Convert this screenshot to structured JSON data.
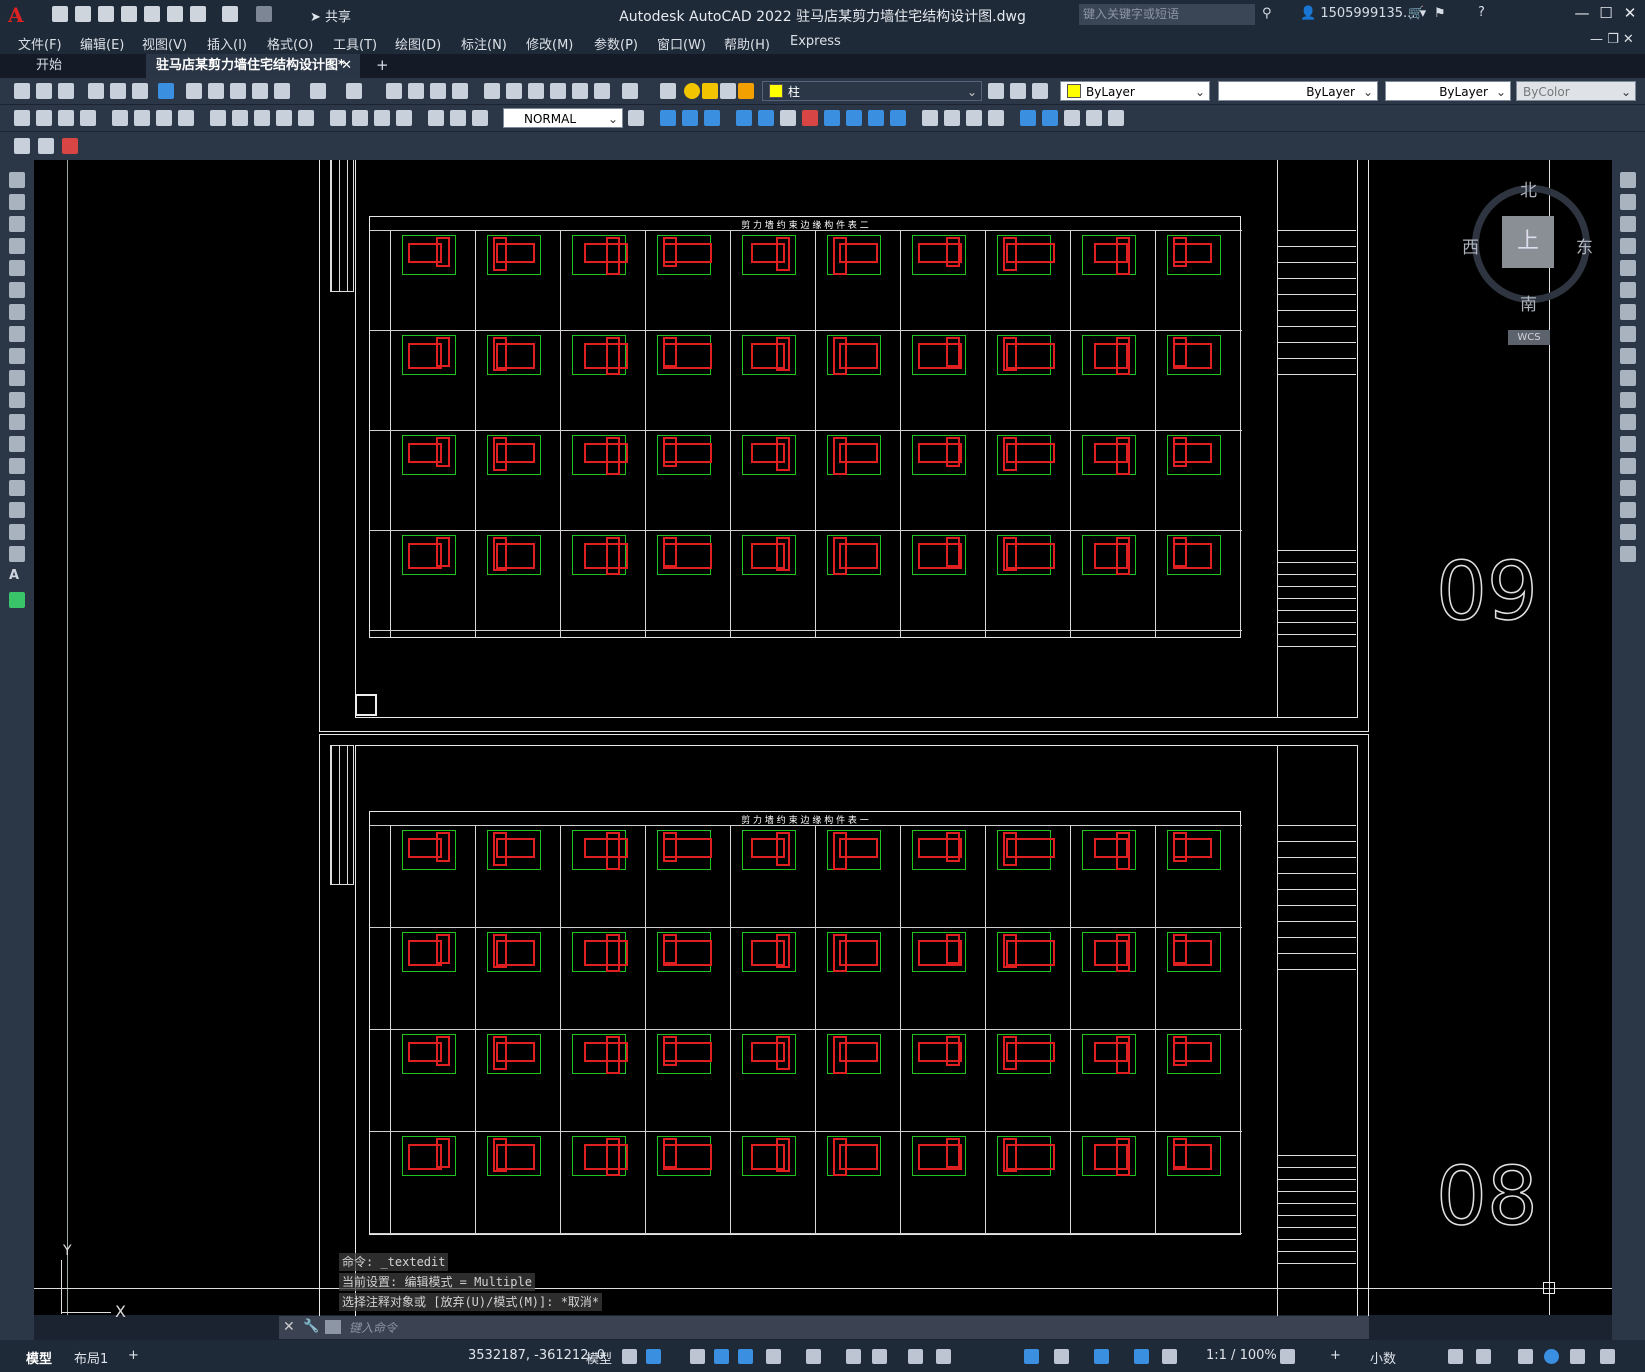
{
  "app": {
    "title": "Autodesk AutoCAD 2022    驻马店某剪力墙住宅结构设计图.dwg",
    "share_label": "共享",
    "search_placeholder": "键入关键字或短语",
    "user": "1505999135...",
    "logo": "A"
  },
  "menu": [
    "文件(F)",
    "编辑(E)",
    "视图(V)",
    "插入(I)",
    "格式(O)",
    "工具(T)",
    "绘图(D)",
    "标注(N)",
    "修改(M)",
    "参数(P)",
    "窗口(W)",
    "帮助(H)",
    "Express"
  ],
  "tabs": [
    {
      "label": "开始"
    },
    {
      "label": "驻马店某剪力墙住宅结构设计图*"
    }
  ],
  "toolbar": {
    "layer_combo": "柱",
    "color_combo": "ByLayer",
    "linetype_combo": "ByLayer",
    "lineweight_combo": "ByLayer",
    "plotstyle_combo": "ByColor",
    "textstyle_combo": "NORMAL"
  },
  "viewcube": {
    "north": "北",
    "south": "南",
    "east": "东",
    "west": "西",
    "top": "上",
    "wcs": "WCS"
  },
  "drawing": {
    "sheet_upper": {
      "number": "09",
      "table_title": "剪 力 墙 约 束 边 缘 构 件 表 二"
    },
    "sheet_lower": {
      "number": "08",
      "table_title": "剪 力 墙 约 束 边 缘 构 件 表 一"
    }
  },
  "ucs": {
    "y_label": "Y",
    "x_label": "X"
  },
  "command": {
    "history": [
      "命令: _textedit",
      "当前设置: 编辑模式 = Multiple",
      "选择注释对象或 [放弃(U)/模式(M)]: *取消*"
    ],
    "input_placeholder": "键入命令"
  },
  "status": {
    "layout_tabs": [
      "模型",
      "布局1"
    ],
    "coords": "3532187, -361212, 0",
    "space": "模型",
    "scale": "1:1 / 100%",
    "units": "小数"
  }
}
